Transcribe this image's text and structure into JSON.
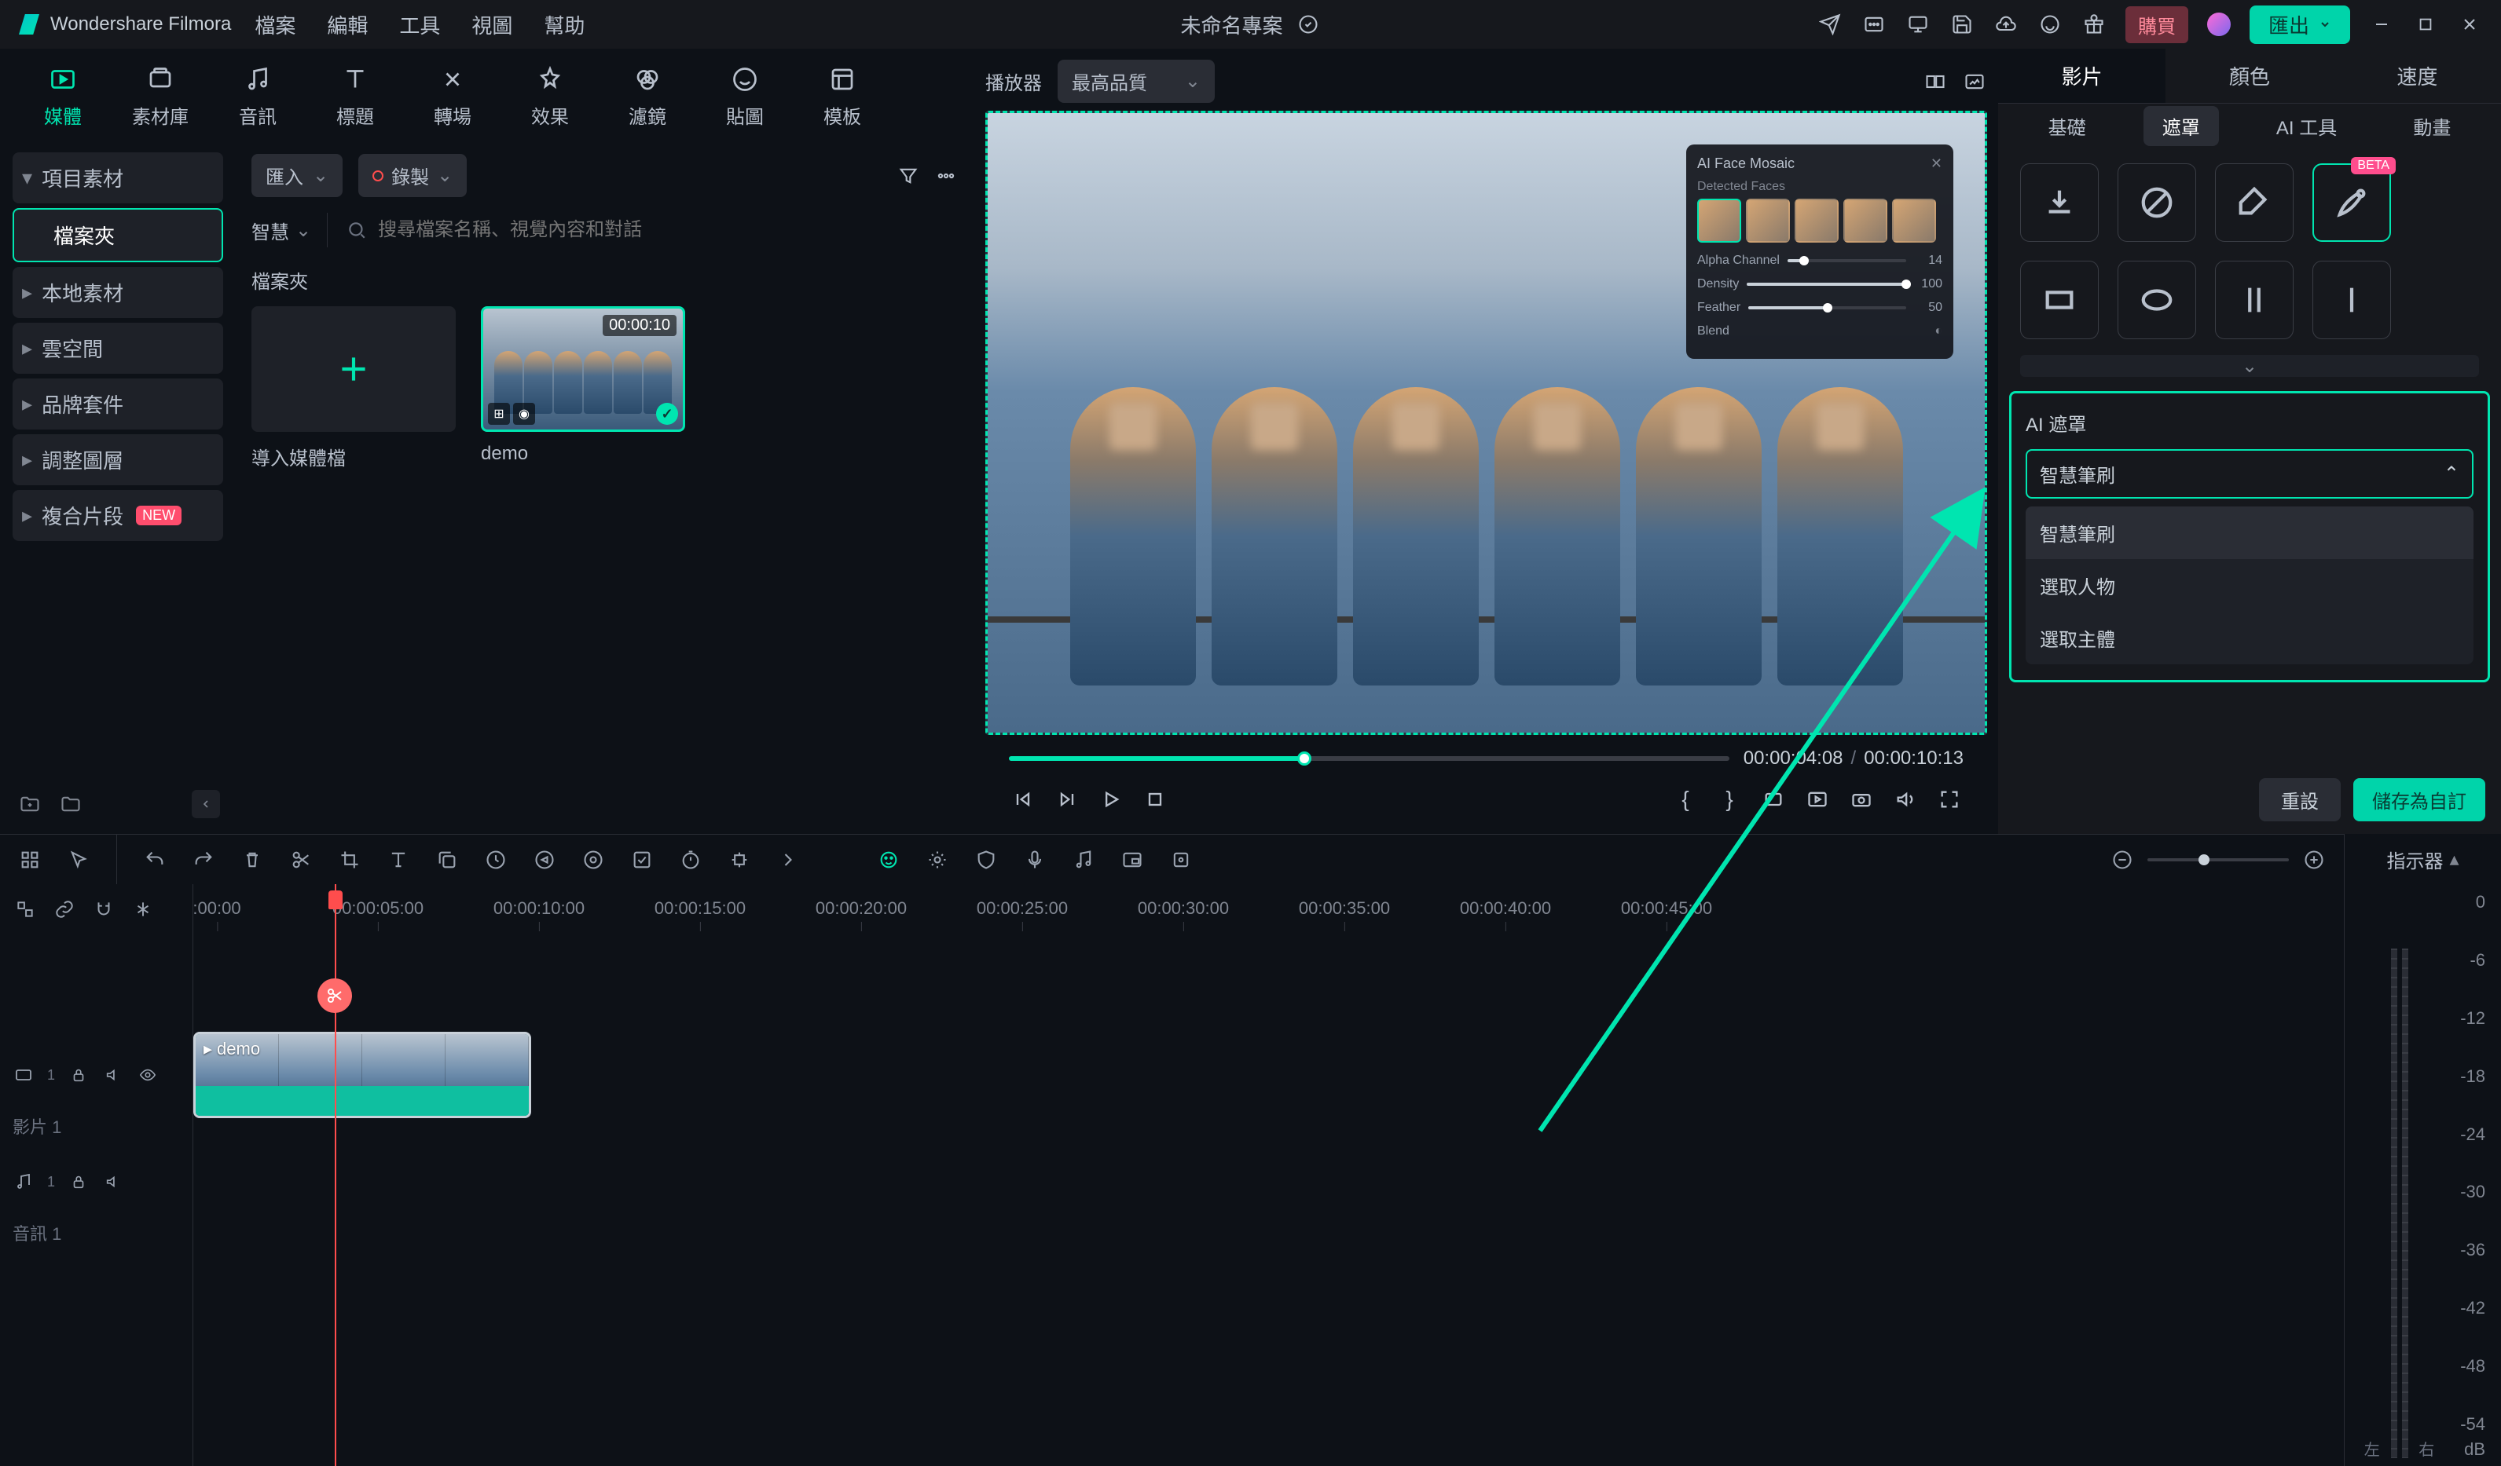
{
  "app": {
    "name": "Wondershare Filmora"
  },
  "menu": [
    "檔案",
    "編輯",
    "工具",
    "視圖",
    "幫助"
  ],
  "project_title": "未命名專案",
  "titlebar": {
    "buy": "購買",
    "export": "匯出"
  },
  "toptabs": [
    {
      "id": "media",
      "label": "媒體"
    },
    {
      "id": "stock",
      "label": "素材庫"
    },
    {
      "id": "audio",
      "label": "音訊"
    },
    {
      "id": "title",
      "label": "標題"
    },
    {
      "id": "transition",
      "label": "轉場"
    },
    {
      "id": "effect",
      "label": "效果"
    },
    {
      "id": "filter",
      "label": "濾鏡"
    },
    {
      "id": "sticker",
      "label": "貼圖"
    },
    {
      "id": "template",
      "label": "模板"
    }
  ],
  "sidebar": {
    "items": [
      {
        "label": "項目素材"
      },
      {
        "label": "檔案夾",
        "selected": true
      },
      {
        "label": "本地素材"
      },
      {
        "label": "雲空間"
      },
      {
        "label": "品牌套件"
      },
      {
        "label": "調整圖層"
      },
      {
        "label": "複合片段",
        "new": true
      }
    ]
  },
  "media": {
    "import_dd": "匯入",
    "record_dd": "錄製",
    "search_dd": "智慧",
    "search_placeholder": "搜尋檔案名稱、視覺內容和對話",
    "folder_label": "檔案夾",
    "import_label": "導入媒體檔",
    "demo": {
      "name": "demo",
      "duration": "00:00:10"
    }
  },
  "preview": {
    "player_label": "播放器",
    "quality": "最高品質",
    "current": "00:00:04:08",
    "total": "00:00:10:13",
    "float": {
      "title": "AI Face Mosaic",
      "section": "Detected Faces",
      "rows": [
        {
          "label": "Alpha Channel",
          "val": "14"
        },
        {
          "label": "Density",
          "val": "100"
        },
        {
          "label": "Feather",
          "val": "50"
        },
        {
          "label": "Blend",
          "val": ""
        }
      ]
    }
  },
  "props": {
    "tabs": [
      "影片",
      "顏色",
      "速度"
    ],
    "subtabs": [
      "基礎",
      "遮罩",
      "AI 工具",
      "動畫"
    ],
    "beta": "BETA",
    "ai_mask": {
      "title": "AI 遮罩",
      "selected": "智慧筆刷",
      "options": [
        "智慧筆刷",
        "選取人物",
        "選取主體"
      ]
    },
    "reset": "重設",
    "save": "儲存為自訂"
  },
  "timeline": {
    "indicator": "指示器",
    "ticks": [
      ":00:00",
      "00:00:05:00",
      "00:00:10:00",
      "00:00:15:00",
      "00:00:20:00",
      "00:00:25:00",
      "00:00:30:00",
      "00:00:35:00",
      "00:00:40:00",
      "00:00:45:00"
    ],
    "video_track": "影片 1",
    "audio_track": "音訊 1",
    "clip_name": "demo",
    "meter": {
      "labels": [
        "0",
        "-6",
        "-12",
        "-18",
        "-24",
        "-30",
        "-36",
        "-42",
        "-48",
        "-54"
      ],
      "lr": [
        "左",
        "右"
      ],
      "db": "dB"
    }
  }
}
